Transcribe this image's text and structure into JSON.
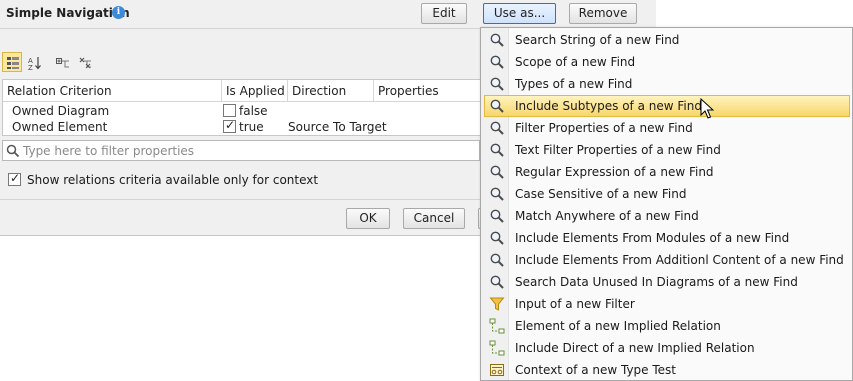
{
  "dialog": {
    "title": "Simple Navigation",
    "buttons": {
      "edit": "Edit",
      "use_as": "Use as...",
      "remove": "Remove"
    },
    "table": {
      "headers": [
        "Relation Criterion",
        "Is Applied",
        "Direction",
        "Properties"
      ],
      "rows": [
        {
          "criterion": "Owned Diagram",
          "applied": false,
          "applied_text": "false",
          "direction": "",
          "properties": ""
        },
        {
          "criterion": "Owned Element",
          "applied": true,
          "applied_text": "true",
          "direction": "Source To Target",
          "properties": ""
        }
      ]
    },
    "filter": {
      "placeholder": "Type here to filter properties",
      "value": ""
    },
    "context_checkbox": {
      "label": "Show relations criteria available only for context",
      "checked": true
    },
    "footer": {
      "ok": "OK",
      "cancel": "Cancel"
    }
  },
  "menu": {
    "items": [
      {
        "label": "Search String of a new Find",
        "icon": "search-icon"
      },
      {
        "label": "Scope of a new Find",
        "icon": "search-icon"
      },
      {
        "label": "Types of a new Find",
        "icon": "search-icon"
      },
      {
        "label": "Include Subtypes of a new Find",
        "icon": "search-icon",
        "highlighted": true
      },
      {
        "label": "Filter Properties of a new Find",
        "icon": "search-icon"
      },
      {
        "label": "Text Filter Properties of a new Find",
        "icon": "search-icon"
      },
      {
        "label": "Regular Expression of a new Find",
        "icon": "search-icon"
      },
      {
        "label": "Case Sensitive of a new Find",
        "icon": "search-icon"
      },
      {
        "label": "Match Anywhere of a new Find",
        "icon": "search-icon"
      },
      {
        "label": "Include Elements From Modules of a new Find",
        "icon": "search-icon"
      },
      {
        "label": "Include Elements From Additionl Content of a new Find",
        "icon": "search-icon"
      },
      {
        "label": "Search Data Unused In Diagrams of a new Find",
        "icon": "search-icon"
      },
      {
        "label": "Input of a new Filter",
        "icon": "filter-funnel-icon"
      },
      {
        "label": "Element of a new Implied Relation",
        "icon": "implied-relation-icon"
      },
      {
        "label": "Include Direct of a new Implied Relation",
        "icon": "implied-relation-icon"
      },
      {
        "label": "Context of a new Type Test",
        "icon": "type-test-icon"
      }
    ]
  },
  "colors": {
    "highlight": "#f7d66a",
    "accent": "#2f6fd0",
    "info": "#3f8ad8"
  }
}
